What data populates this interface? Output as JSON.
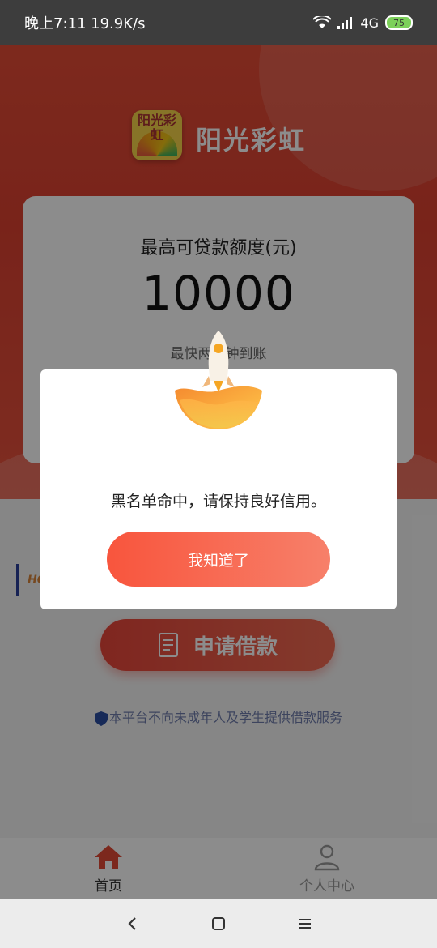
{
  "status_bar": {
    "time_speed": "晚上7:11 19.9K/s",
    "network": "4G",
    "battery": "75"
  },
  "brand": {
    "logo_text": "阳光彩虹",
    "name": "阳光彩虹"
  },
  "loan_card": {
    "label": "最高可贷款额度(元)",
    "amount": "10000",
    "subtitle": "最快两分钟到账"
  },
  "notice": {
    "text": "HOT"
  },
  "apply_button": {
    "label": "申请借款"
  },
  "disclaimer": {
    "text": "本平台不向未成年人及学生提供借款服务"
  },
  "tabs": [
    {
      "label": "首页",
      "icon": "home-icon",
      "active": true
    },
    {
      "label": "个人中心",
      "icon": "person-icon",
      "active": false
    }
  ],
  "nav": {
    "back": "back-icon",
    "home": "home-square-icon",
    "menu": "menu-icon"
  },
  "dialog": {
    "message": "黑名单命中，请保持良好信用。",
    "button": "我知道了",
    "icon": "rocket-icon"
  },
  "colors": {
    "accent": "#e44c36",
    "tab_active": "#e24a35",
    "tab_inactive": "#9a9a9a"
  }
}
